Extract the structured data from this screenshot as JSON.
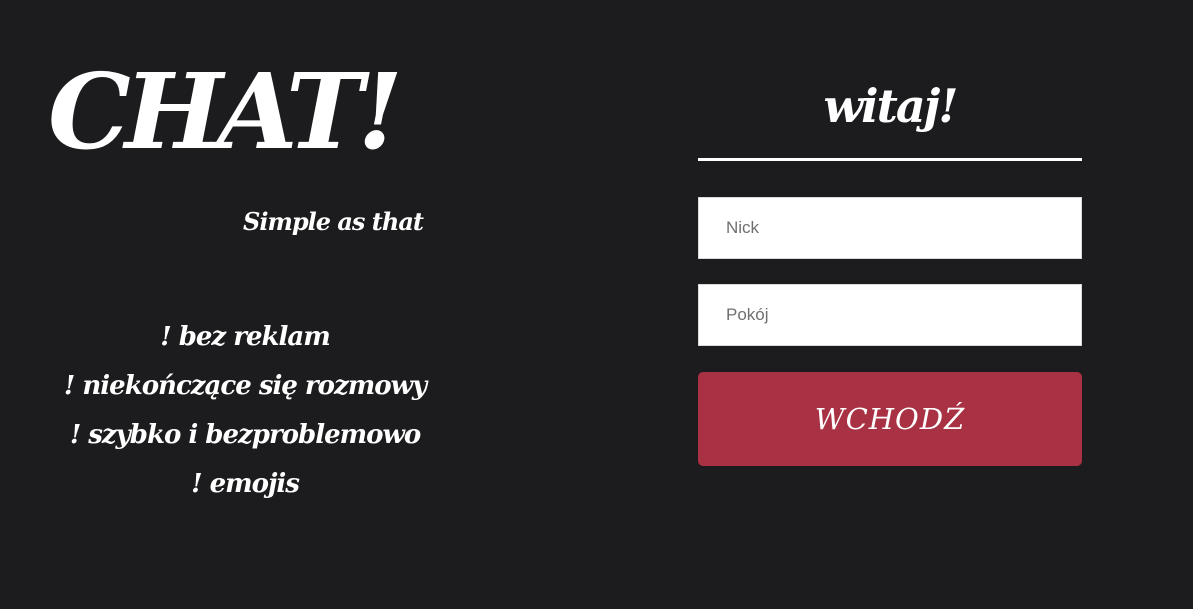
{
  "brand": {
    "title": "CHAT!",
    "tagline": "Simple as that"
  },
  "features": [
    "! bez reklam",
    "! niekończące się rozmowy",
    "! szybko i bezproblemowo",
    "! emojis"
  ],
  "login": {
    "greeting": "witaj!",
    "nick_placeholder": "Nick",
    "nick_value": "",
    "room_placeholder": "Pokój",
    "room_value": "",
    "submit_label": "WCHODŹ"
  },
  "colors": {
    "background": "#1c1b1e",
    "text": "#ffffff",
    "accent": "#a83143",
    "field_background": "#ffffff"
  }
}
